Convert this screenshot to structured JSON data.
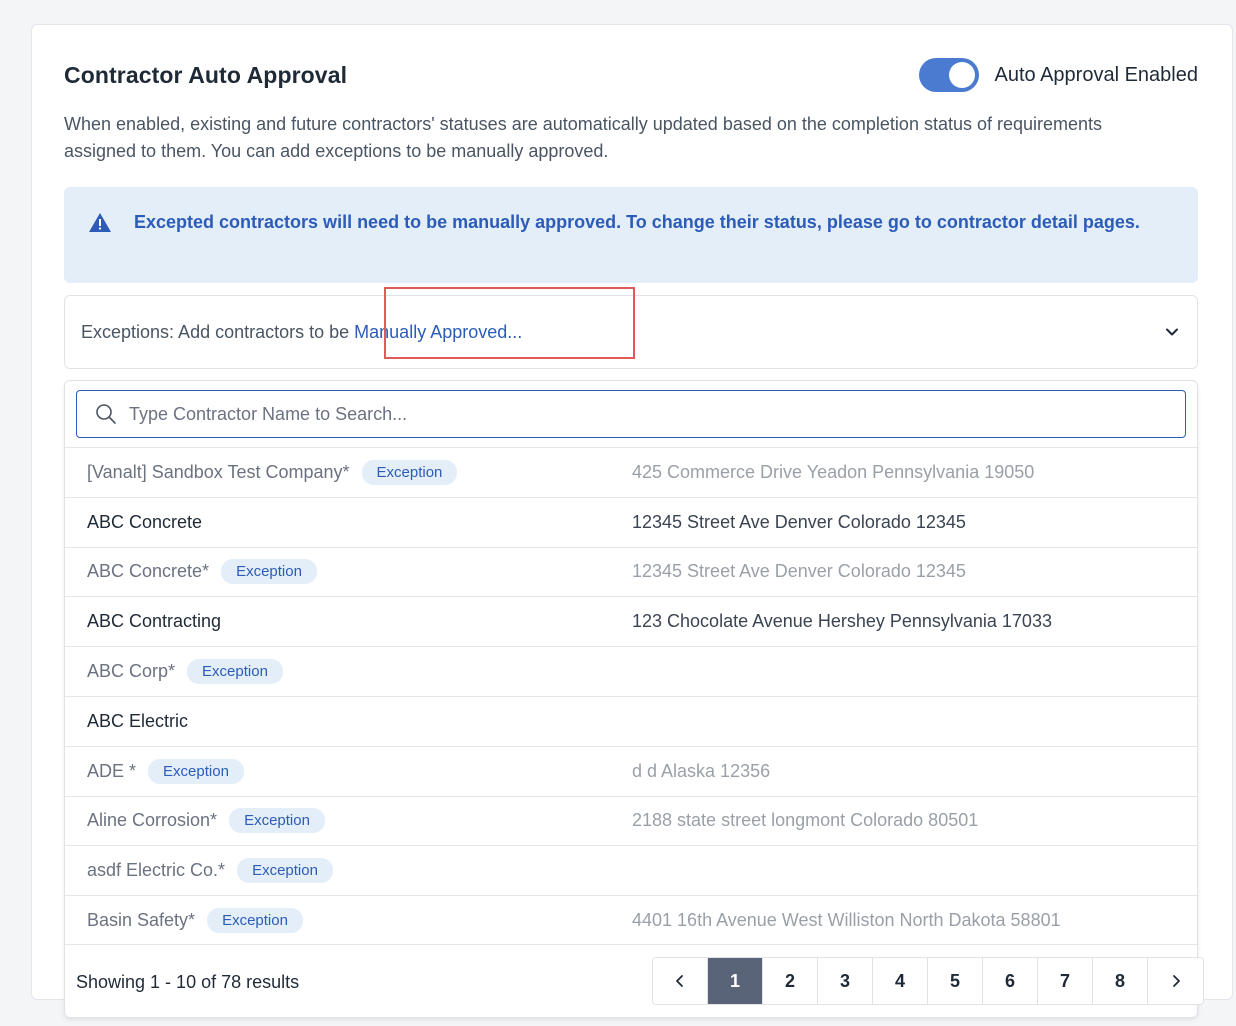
{
  "header": {
    "title": "Contractor Auto Approval",
    "toggle_label": "Auto Approval Enabled",
    "toggle_on": true
  },
  "description": "When enabled, existing and future contractors' statuses are automatically updated based on the completion status of requirements assigned to them. You can add exceptions to be manually approved.",
  "alert": {
    "icon": "warning-triangle-icon",
    "text": "Excepted contractors will need to be manually approved. To change their status, please go to contractor detail pages."
  },
  "exceptions": {
    "prefix": "Exceptions: Add contractors to be ",
    "link": "Manually Approved..."
  },
  "search": {
    "placeholder": "Type Contractor Name to Search..."
  },
  "contractors": [
    {
      "name": "[Vanalt] Sandbox Test Company*",
      "badge": "Exception",
      "address": "425 Commerce Drive Yeadon Pennsylvania 19050",
      "muted": true
    },
    {
      "name": "ABC Concrete",
      "badge": "",
      "address": "12345 Street Ave Denver Colorado 12345",
      "muted": false
    },
    {
      "name": "ABC Concrete*",
      "badge": "Exception",
      "address": "12345 Street Ave Denver Colorado 12345",
      "muted": true
    },
    {
      "name": "ABC Contracting",
      "badge": "",
      "address": "123 Chocolate Avenue Hershey Pennsylvania 17033",
      "muted": false
    },
    {
      "name": "ABC Corp*",
      "badge": "Exception",
      "address": "",
      "muted": true
    },
    {
      "name": "ABC Electric",
      "badge": "",
      "address": "",
      "muted": false
    },
    {
      "name": "ADE *",
      "badge": "Exception",
      "address": "d d Alaska 12356",
      "muted": true
    },
    {
      "name": "Aline Corrosion*",
      "badge": "Exception",
      "address": "2188 state street longmont Colorado 80501",
      "muted": true
    },
    {
      "name": "asdf Electric Co.*",
      "badge": "Exception",
      "address": "",
      "muted": true
    },
    {
      "name": "Basin Safety*",
      "badge": "Exception",
      "address": "4401 16th Avenue West Williston North Dakota 58801",
      "muted": true
    }
  ],
  "footer": {
    "showing": "Showing 1 - 10 of 78 results",
    "pages": [
      "1",
      "2",
      "3",
      "4",
      "5",
      "6",
      "7",
      "8"
    ],
    "active_page": "1"
  },
  "colors": {
    "accent": "#2c5cb8",
    "toggle": "#4a7bd0",
    "alert_bg": "#e3eef9",
    "active_page_bg": "#5a6478",
    "highlight": "#e05a5a"
  }
}
